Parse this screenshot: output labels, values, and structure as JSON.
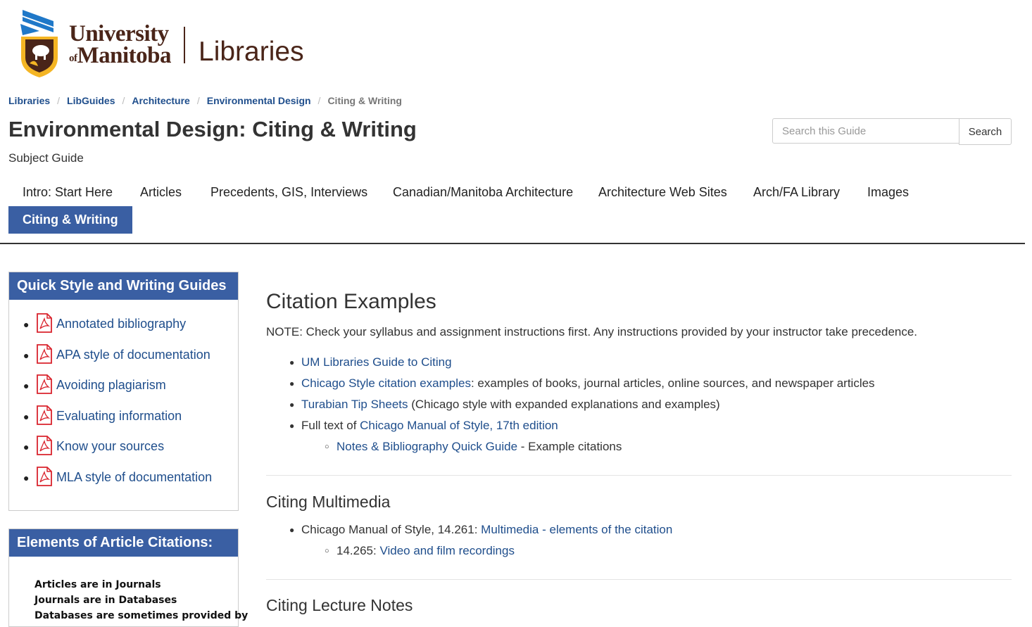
{
  "logo": {
    "university_line1": "University",
    "university_of": "of",
    "university_line2": "Manitoba",
    "libraries": "Libraries"
  },
  "breadcrumb": [
    "Libraries",
    "LibGuides",
    "Architecture",
    "Environmental Design",
    "Citing & Writing"
  ],
  "page": {
    "title": "Environmental Design: Citing & Writing",
    "subtitle": "Subject Guide"
  },
  "search": {
    "placeholder": "Search this Guide",
    "button": "Search"
  },
  "tabs": [
    {
      "label": "Intro: Start Here",
      "active": false
    },
    {
      "label": "Articles",
      "active": false
    },
    {
      "label": "Precedents, GIS, Interviews",
      "active": false
    },
    {
      "label": "Canadian/Manitoba Architecture",
      "active": false
    },
    {
      "label": "Architecture Web Sites",
      "active": false
    },
    {
      "label": "Arch/FA Library",
      "active": false
    },
    {
      "label": "Images",
      "active": false
    },
    {
      "label": "Citing & Writing",
      "active": true
    }
  ],
  "sidebar": {
    "quick_guides": {
      "title": "Quick Style and Writing Guides",
      "items": [
        "Annotated bibliography",
        "APA style of documentation",
        "Avoiding plagiarism",
        "Evaluating information",
        "Know your sources",
        "MLA style of documentation"
      ]
    },
    "elements": {
      "title": "Elements of Article Citations:",
      "lines": [
        "Articles are in Journals",
        "Journals are in Databases",
        "Databases are sometimes provided by"
      ]
    }
  },
  "main": {
    "citation_examples": {
      "heading": "Citation Examples",
      "note": "NOTE: Check your syllabus and assignment instructions first. Any instructions provided by your instructor take precedence.",
      "item1_link": "UM Libraries Guide to Citing",
      "item2_link": "Chicago Style citation examples",
      "item2_text": ": examples of books, journal articles, online sources, and newspaper articles",
      "item3_link": "Turabian Tip Sheets",
      "item3_text": " (Chicago style with expanded explanations and examples)",
      "item4_text": "Full text of ",
      "item4_link": "Chicago Manual of Style, 17th edition",
      "sub_link": "Notes & Bibliography Quick Guide",
      "sub_text": " - Example citations"
    },
    "citing_multimedia": {
      "heading": "Citing Multimedia",
      "item_text": "Chicago Manual of Style, 14.261: ",
      "item_link1": "Multimedia",
      "item_dash": " - ",
      "item_link2": "elements of the citation",
      "sub_text": "14.265: ",
      "sub_link": "Video and film recordings"
    },
    "citing_lecture": {
      "heading": "Citing Lecture Notes"
    }
  },
  "colors": {
    "brand_blue": "#3a5fa3",
    "link": "#1f4e8c",
    "logo_brown": "#4a2519",
    "pdf_red": "#d9232d"
  }
}
